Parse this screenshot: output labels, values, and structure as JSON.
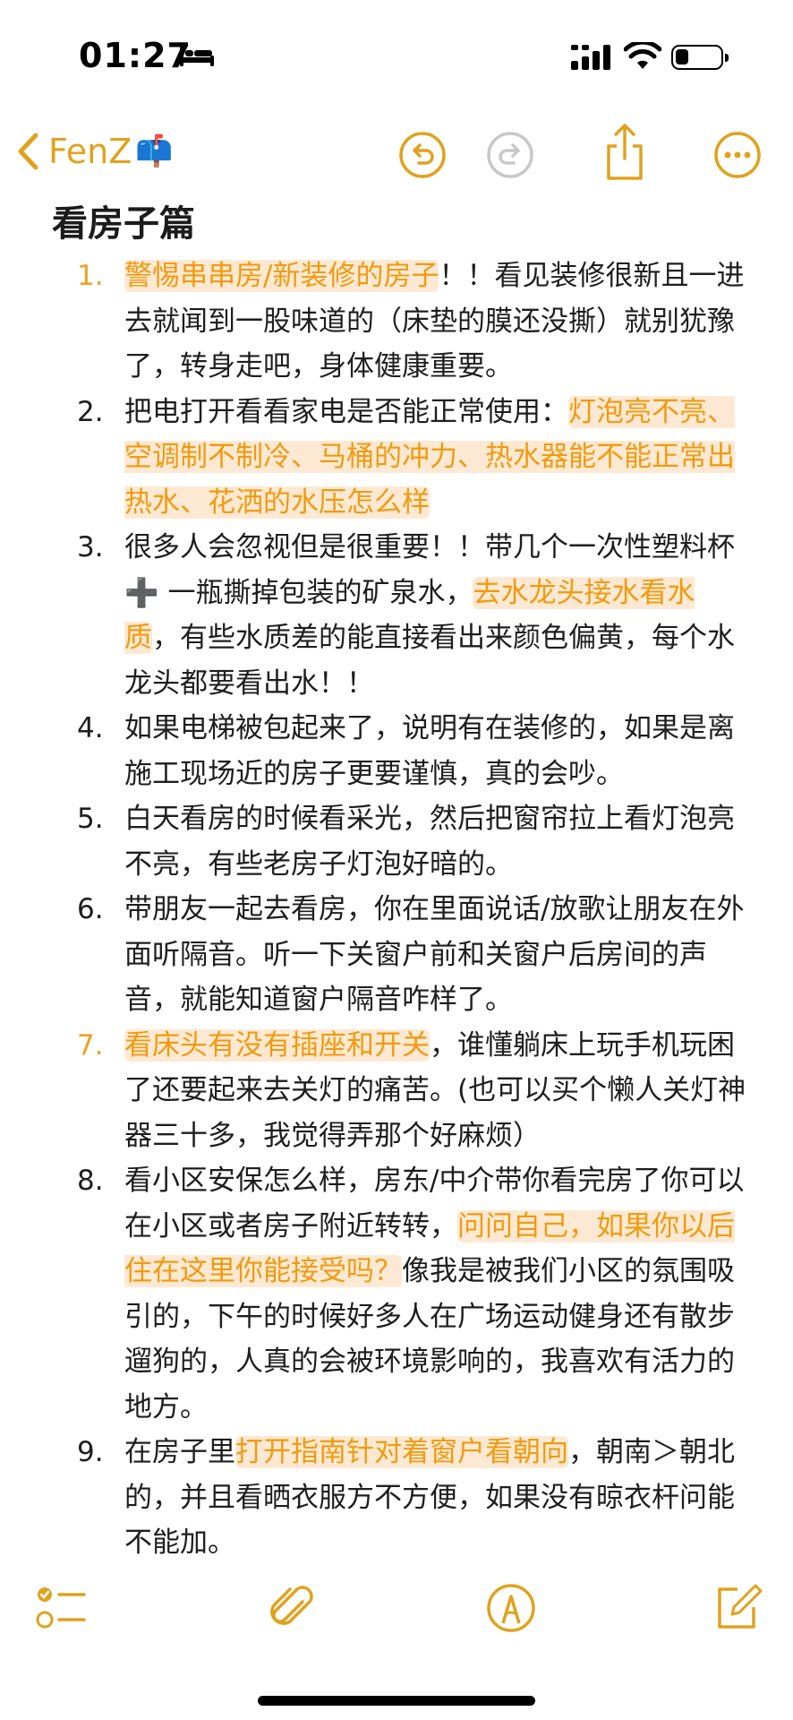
{
  "status_bar": {
    "time": "01:27"
  },
  "nav": {
    "back_label": "FenZ",
    "back_emoji": "📫"
  },
  "note": {
    "title": "看房子篇",
    "items": [
      {
        "num": "1.",
        "num_highlight": true,
        "parts": [
          {
            "text": "警惕串串房/新装修的房子",
            "hl": true
          },
          {
            "text": "！！看见装修很新且一进去就闻到一股味道的（床垫的膜还没撕）就别犹豫了，转身走吧，身体健康重要。",
            "hl": false
          }
        ]
      },
      {
        "num": "2.",
        "num_highlight": false,
        "parts": [
          {
            "text": "把电打开看看家电是否能正常使用：",
            "hl": false
          },
          {
            "text": "灯泡亮不亮、空调制不制冷、马桶的冲力、热水器能不能正常出热水、花洒的水压怎么样",
            "hl": true
          }
        ]
      },
      {
        "num": "3.",
        "num_highlight": false,
        "parts": [
          {
            "text": "很多人会忽视但是很重要！！带几个一次性塑料杯 ➕ 一瓶撕掉包装的矿泉水，",
            "hl": false
          },
          {
            "text": "去水龙头接水看水质",
            "hl": true
          },
          {
            "text": "，有些水质差的能直接看出来颜色偏黄，每个水龙头都要看出水！！",
            "hl": false
          }
        ]
      },
      {
        "num": "4.",
        "num_highlight": false,
        "parts": [
          {
            "text": "如果电梯被包起来了，说明有在装修的，如果是离施工现场近的房子更要谨慎，真的会吵。",
            "hl": false
          }
        ]
      },
      {
        "num": "5.",
        "num_highlight": false,
        "parts": [
          {
            "text": "白天看房的时候看采光，然后把窗帘拉上看灯泡亮不亮，有些老房子灯泡好暗的。",
            "hl": false
          }
        ]
      },
      {
        "num": "6.",
        "num_highlight": false,
        "parts": [
          {
            "text": "带朋友一起去看房，你在里面说话/放歌让朋友在外面听隔音。听一下关窗户前和关窗户后房间的声音，就能知道窗户隔音咋样了。",
            "hl": false
          }
        ]
      },
      {
        "num": "7.",
        "num_highlight": true,
        "parts": [
          {
            "text": "看床头有没有插座和开关",
            "hl": true
          },
          {
            "text": "，谁懂躺床上玩手机玩困了还要起来去关灯的痛苦。(也可以买个懒人关灯神器三十多，我觉得弄那个好麻烦）",
            "hl": false
          }
        ]
      },
      {
        "num": "8.",
        "num_highlight": false,
        "parts": [
          {
            "text": "看小区安保怎么样，房东/中介带你看完房了你可以在小区或者房子附近转转，",
            "hl": false
          },
          {
            "text": "问问自己，如果你以后住在这里你能接受吗？",
            "hl": true
          },
          {
            "text": "像我是被我们小区的氛围吸引的，下午的时候好多人在广场运动健身还有散步遛狗的，人真的会被环境影响的，我喜欢有活力的地方。",
            "hl": false
          }
        ]
      },
      {
        "num": "9.",
        "num_highlight": false,
        "parts": [
          {
            "text": "在房子里",
            "hl": false
          },
          {
            "text": "打开指南针对着窗户看朝向",
            "hl": true
          },
          {
            "text": "，朝南＞朝北的，并且看晒衣服方不方便，如果没有晾衣杆问能不能加。",
            "hl": false
          }
        ]
      }
    ]
  },
  "icons": {
    "accent": "#e0a21e",
    "disabled": "#c8c8c8",
    "highlight_bg": "#fde9d3",
    "highlight_text": "#f19a0e"
  }
}
